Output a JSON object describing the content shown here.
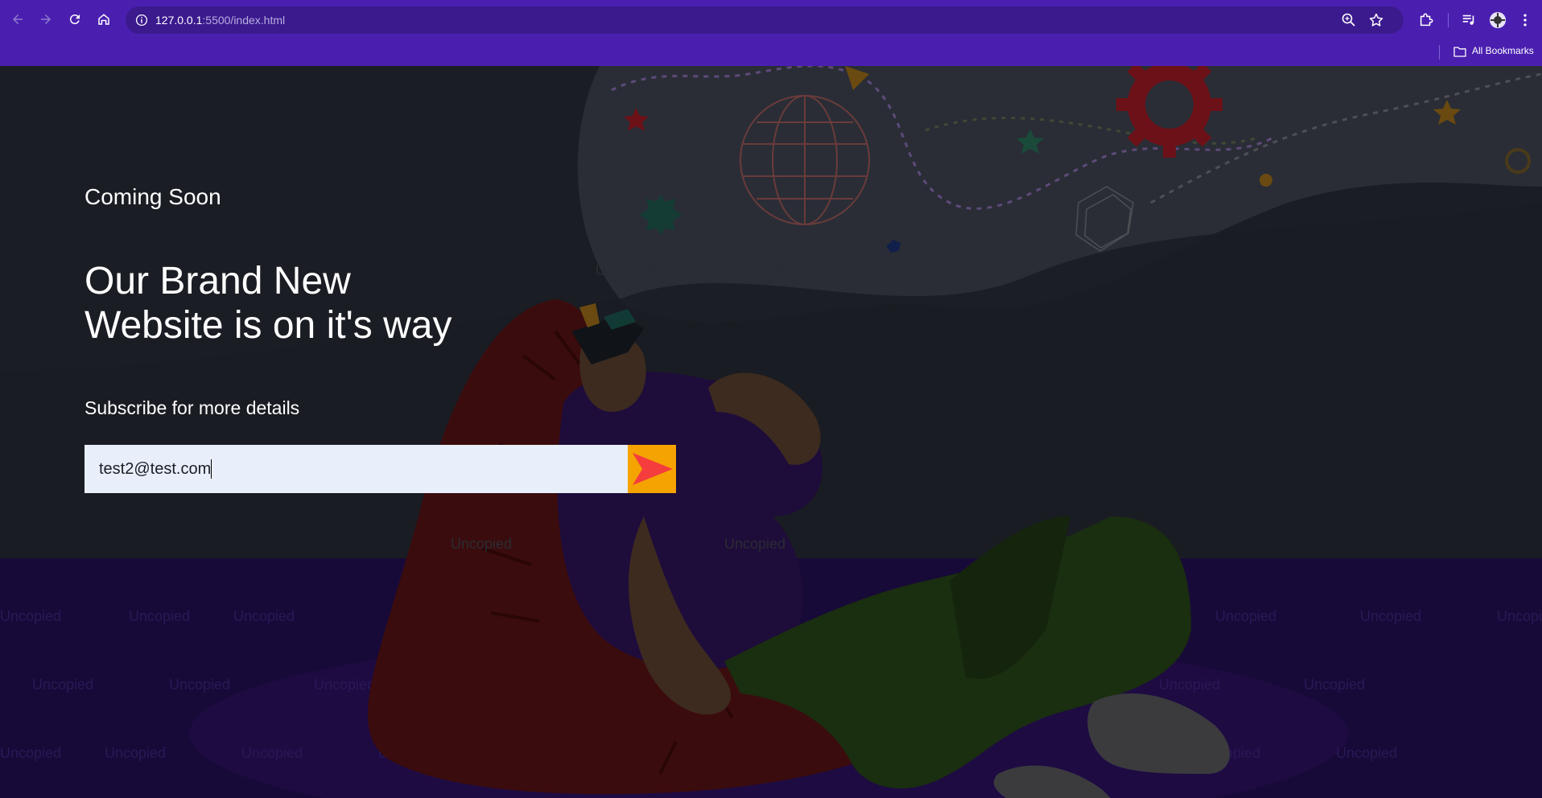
{
  "browser": {
    "url_host": "127.0.0.1",
    "url_rest": ":5500/index.html",
    "bookmarks_label": "All Bookmarks",
    "accent": "#4a1fb0"
  },
  "hero": {
    "eyebrow": "Coming Soon",
    "headline_line1": "Our Brand New",
    "headline_line2": "Website is on it's way",
    "subscribe_label": "Subscribe for more details",
    "email_value": "test2@test.com",
    "submit_icon": "arrow-right-icon",
    "submit_color": "#f5a300"
  },
  "illustration": {
    "subject": "person-with-vr-headset-on-beanbag",
    "background_text": "Uncopied"
  }
}
